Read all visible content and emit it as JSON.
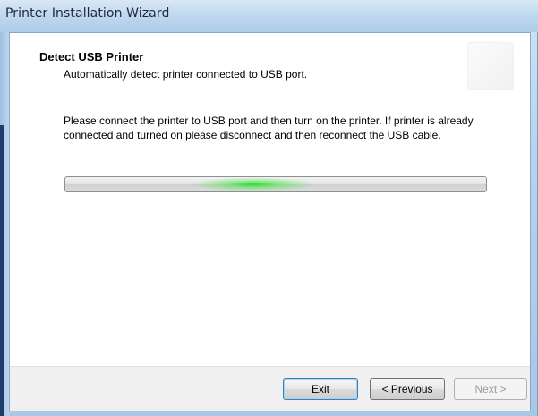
{
  "window": {
    "title": "Printer Installation Wizard"
  },
  "header": {
    "title": "Detect USB Printer",
    "subtitle": "Automatically detect printer connected to USB port."
  },
  "main": {
    "instructions": "Please connect the printer to USB port and then turn on the printer. If printer is already connected and turned on please disconnect and then reconnect the USB cable.",
    "progress": {
      "style": "indeterminate marquee",
      "glow_color": "#2ddc2d"
    }
  },
  "footer": {
    "exit_label": "Exit",
    "previous_label": "< Previous",
    "next_label": "Next >",
    "next_enabled": false
  },
  "colors": {
    "title_bar": "#bcd6ee",
    "footer_bg": "#f0f0f0",
    "focus_border": "#3c7fb1"
  }
}
